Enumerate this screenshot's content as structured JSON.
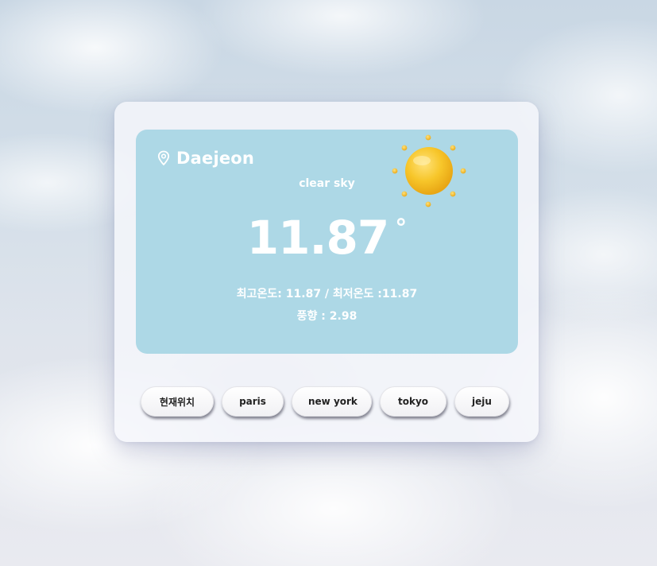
{
  "weather": {
    "city": "Daejeon",
    "description": "clear sky",
    "temperature": "11.87",
    "degree_symbol": "°",
    "minmax": "최고온도: 11.87 / 최저온도 :11.87",
    "wind": "풍향 : 2.98",
    "icon": "sun-icon"
  },
  "buttons": [
    {
      "label": "현재위치"
    },
    {
      "label": "paris"
    },
    {
      "label": "new york"
    },
    {
      "label": "tokyo"
    },
    {
      "label": "jeju"
    }
  ],
  "colors": {
    "panel_background": "#add8e6",
    "text": "#ffffff",
    "sun": "#f5c518"
  }
}
